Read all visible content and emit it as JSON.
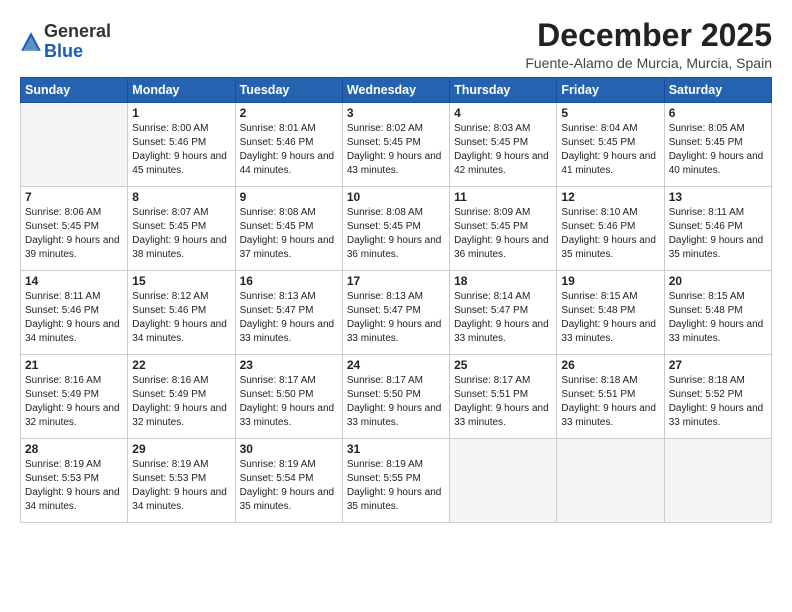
{
  "logo": {
    "general": "General",
    "blue": "Blue"
  },
  "header": {
    "month": "December 2025",
    "location": "Fuente-Alamo de Murcia, Murcia, Spain"
  },
  "weekdays": [
    "Sunday",
    "Monday",
    "Tuesday",
    "Wednesday",
    "Thursday",
    "Friday",
    "Saturday"
  ],
  "weeks": [
    [
      {
        "day": "",
        "sunrise": "",
        "sunset": "",
        "daylight": ""
      },
      {
        "day": "1",
        "sunrise": "Sunrise: 8:00 AM",
        "sunset": "Sunset: 5:46 PM",
        "daylight": "Daylight: 9 hours and 45 minutes."
      },
      {
        "day": "2",
        "sunrise": "Sunrise: 8:01 AM",
        "sunset": "Sunset: 5:46 PM",
        "daylight": "Daylight: 9 hours and 44 minutes."
      },
      {
        "day": "3",
        "sunrise": "Sunrise: 8:02 AM",
        "sunset": "Sunset: 5:45 PM",
        "daylight": "Daylight: 9 hours and 43 minutes."
      },
      {
        "day": "4",
        "sunrise": "Sunrise: 8:03 AM",
        "sunset": "Sunset: 5:45 PM",
        "daylight": "Daylight: 9 hours and 42 minutes."
      },
      {
        "day": "5",
        "sunrise": "Sunrise: 8:04 AM",
        "sunset": "Sunset: 5:45 PM",
        "daylight": "Daylight: 9 hours and 41 minutes."
      },
      {
        "day": "6",
        "sunrise": "Sunrise: 8:05 AM",
        "sunset": "Sunset: 5:45 PM",
        "daylight": "Daylight: 9 hours and 40 minutes."
      }
    ],
    [
      {
        "day": "7",
        "sunrise": "Sunrise: 8:06 AM",
        "sunset": "Sunset: 5:45 PM",
        "daylight": "Daylight: 9 hours and 39 minutes."
      },
      {
        "day": "8",
        "sunrise": "Sunrise: 8:07 AM",
        "sunset": "Sunset: 5:45 PM",
        "daylight": "Daylight: 9 hours and 38 minutes."
      },
      {
        "day": "9",
        "sunrise": "Sunrise: 8:08 AM",
        "sunset": "Sunset: 5:45 PM",
        "daylight": "Daylight: 9 hours and 37 minutes."
      },
      {
        "day": "10",
        "sunrise": "Sunrise: 8:08 AM",
        "sunset": "Sunset: 5:45 PM",
        "daylight": "Daylight: 9 hours and 36 minutes."
      },
      {
        "day": "11",
        "sunrise": "Sunrise: 8:09 AM",
        "sunset": "Sunset: 5:45 PM",
        "daylight": "Daylight: 9 hours and 36 minutes."
      },
      {
        "day": "12",
        "sunrise": "Sunrise: 8:10 AM",
        "sunset": "Sunset: 5:46 PM",
        "daylight": "Daylight: 9 hours and 35 minutes."
      },
      {
        "day": "13",
        "sunrise": "Sunrise: 8:11 AM",
        "sunset": "Sunset: 5:46 PM",
        "daylight": "Daylight: 9 hours and 35 minutes."
      }
    ],
    [
      {
        "day": "14",
        "sunrise": "Sunrise: 8:11 AM",
        "sunset": "Sunset: 5:46 PM",
        "daylight": "Daylight: 9 hours and 34 minutes."
      },
      {
        "day": "15",
        "sunrise": "Sunrise: 8:12 AM",
        "sunset": "Sunset: 5:46 PM",
        "daylight": "Daylight: 9 hours and 34 minutes."
      },
      {
        "day": "16",
        "sunrise": "Sunrise: 8:13 AM",
        "sunset": "Sunset: 5:47 PM",
        "daylight": "Daylight: 9 hours and 33 minutes."
      },
      {
        "day": "17",
        "sunrise": "Sunrise: 8:13 AM",
        "sunset": "Sunset: 5:47 PM",
        "daylight": "Daylight: 9 hours and 33 minutes."
      },
      {
        "day": "18",
        "sunrise": "Sunrise: 8:14 AM",
        "sunset": "Sunset: 5:47 PM",
        "daylight": "Daylight: 9 hours and 33 minutes."
      },
      {
        "day": "19",
        "sunrise": "Sunrise: 8:15 AM",
        "sunset": "Sunset: 5:48 PM",
        "daylight": "Daylight: 9 hours and 33 minutes."
      },
      {
        "day": "20",
        "sunrise": "Sunrise: 8:15 AM",
        "sunset": "Sunset: 5:48 PM",
        "daylight": "Daylight: 9 hours and 33 minutes."
      }
    ],
    [
      {
        "day": "21",
        "sunrise": "Sunrise: 8:16 AM",
        "sunset": "Sunset: 5:49 PM",
        "daylight": "Daylight: 9 hours and 32 minutes."
      },
      {
        "day": "22",
        "sunrise": "Sunrise: 8:16 AM",
        "sunset": "Sunset: 5:49 PM",
        "daylight": "Daylight: 9 hours and 32 minutes."
      },
      {
        "day": "23",
        "sunrise": "Sunrise: 8:17 AM",
        "sunset": "Sunset: 5:50 PM",
        "daylight": "Daylight: 9 hours and 33 minutes."
      },
      {
        "day": "24",
        "sunrise": "Sunrise: 8:17 AM",
        "sunset": "Sunset: 5:50 PM",
        "daylight": "Daylight: 9 hours and 33 minutes."
      },
      {
        "day": "25",
        "sunrise": "Sunrise: 8:17 AM",
        "sunset": "Sunset: 5:51 PM",
        "daylight": "Daylight: 9 hours and 33 minutes."
      },
      {
        "day": "26",
        "sunrise": "Sunrise: 8:18 AM",
        "sunset": "Sunset: 5:51 PM",
        "daylight": "Daylight: 9 hours and 33 minutes."
      },
      {
        "day": "27",
        "sunrise": "Sunrise: 8:18 AM",
        "sunset": "Sunset: 5:52 PM",
        "daylight": "Daylight: 9 hours and 33 minutes."
      }
    ],
    [
      {
        "day": "28",
        "sunrise": "Sunrise: 8:19 AM",
        "sunset": "Sunset: 5:53 PM",
        "daylight": "Daylight: 9 hours and 34 minutes."
      },
      {
        "day": "29",
        "sunrise": "Sunrise: 8:19 AM",
        "sunset": "Sunset: 5:53 PM",
        "daylight": "Daylight: 9 hours and 34 minutes."
      },
      {
        "day": "30",
        "sunrise": "Sunrise: 8:19 AM",
        "sunset": "Sunset: 5:54 PM",
        "daylight": "Daylight: 9 hours and 35 minutes."
      },
      {
        "day": "31",
        "sunrise": "Sunrise: 8:19 AM",
        "sunset": "Sunset: 5:55 PM",
        "daylight": "Daylight: 9 hours and 35 minutes."
      },
      {
        "day": "",
        "sunrise": "",
        "sunset": "",
        "daylight": ""
      },
      {
        "day": "",
        "sunrise": "",
        "sunset": "",
        "daylight": ""
      },
      {
        "day": "",
        "sunrise": "",
        "sunset": "",
        "daylight": ""
      }
    ]
  ]
}
